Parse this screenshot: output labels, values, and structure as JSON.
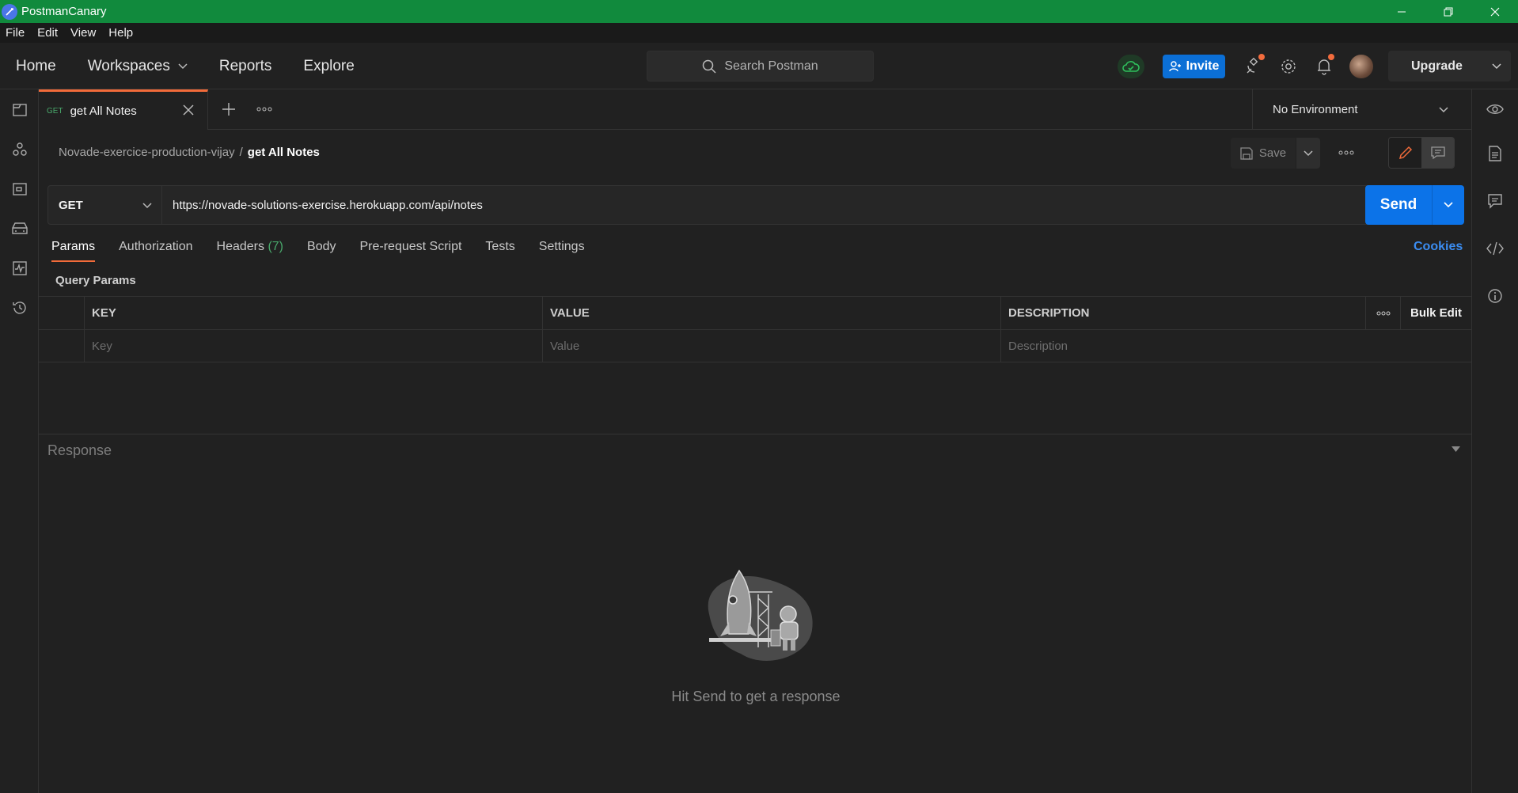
{
  "window": {
    "title": "PostmanCanary"
  },
  "menu": [
    "File",
    "Edit",
    "View",
    "Help"
  ],
  "header": {
    "nav": {
      "home": "Home",
      "workspaces": "Workspaces",
      "reports": "Reports",
      "explore": "Explore"
    },
    "search_placeholder": "Search Postman",
    "invite_label": "Invite",
    "upgrade_label": "Upgrade"
  },
  "tab": {
    "method": "GET",
    "name": "get All Notes"
  },
  "environment": {
    "selected": "No Environment"
  },
  "breadcrumb": {
    "collection": "Novade-exercice-production-vijay",
    "separator": "/",
    "request": "get All Notes"
  },
  "toolbar": {
    "save_label": "Save"
  },
  "request": {
    "method": "GET",
    "url": "https://novade-solutions-exercise.herokuapp.com/api/notes",
    "send_label": "Send"
  },
  "request_tabs": {
    "params": "Params",
    "authorization": "Authorization",
    "headers": "Headers",
    "headers_count": "(7)",
    "body": "Body",
    "prerequest": "Pre-request Script",
    "tests": "Tests",
    "settings": "Settings",
    "cookies": "Cookies"
  },
  "query_params": {
    "title": "Query Params",
    "columns": {
      "key": "KEY",
      "value": "VALUE",
      "description": "DESCRIPTION",
      "bulk_edit": "Bulk Edit"
    },
    "placeholders": {
      "key": "Key",
      "value": "Value",
      "description": "Description"
    }
  },
  "response": {
    "title": "Response",
    "empty_hint": "Hit Send to get a response"
  },
  "colors": {
    "titlebar": "#118a3d",
    "accent": "#f26b3a",
    "send": "#0c73e8",
    "link": "#3b8cf0",
    "count": "#49a86b"
  }
}
